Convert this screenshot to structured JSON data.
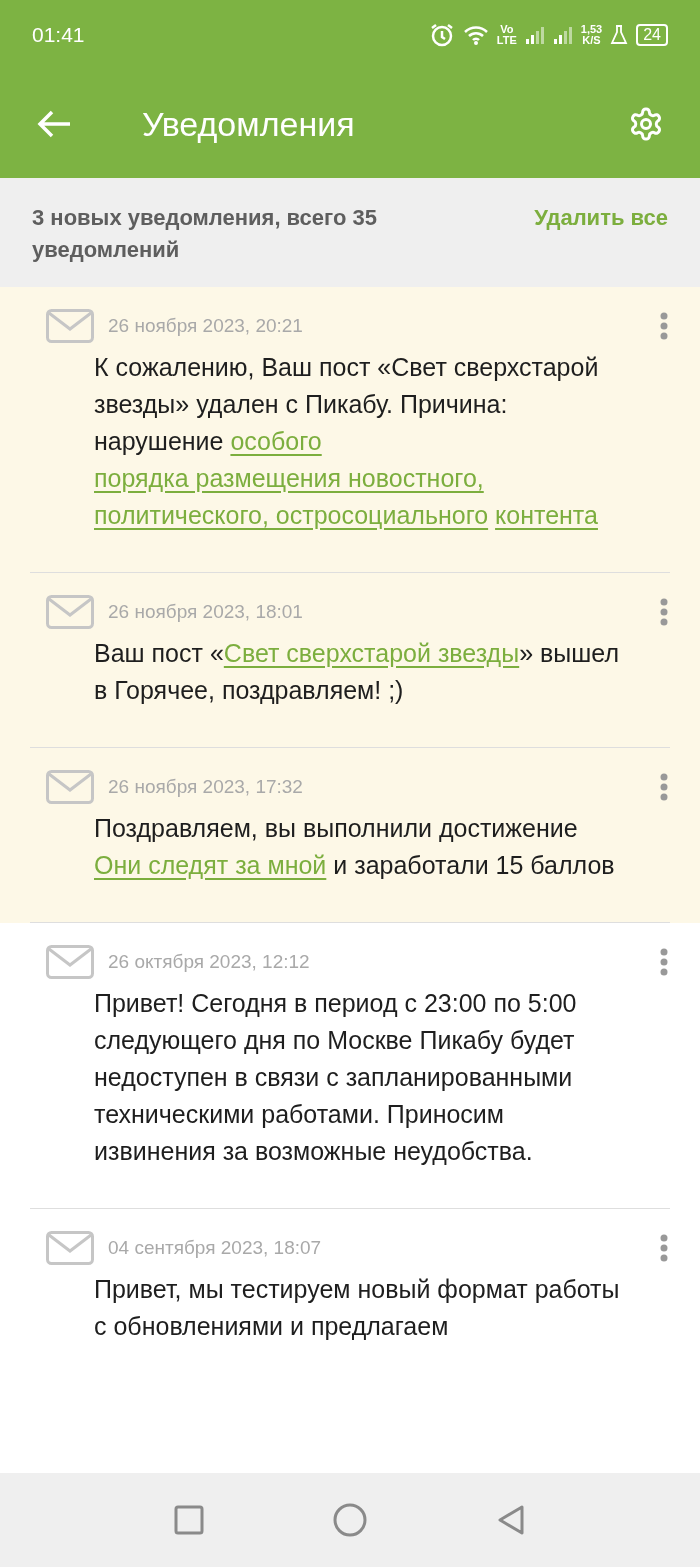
{
  "status_bar": {
    "time": "01:41",
    "network_type_top": "Vo",
    "network_type_bottom": "LTE",
    "speed_value": "1,53",
    "speed_unit": "K/S",
    "battery": "24"
  },
  "app_bar": {
    "title": "Уведомления"
  },
  "summary": {
    "text": "3 новых уведомления, всего 35 уведомлений",
    "action": "Удалить все"
  },
  "notifications": [
    {
      "unread": true,
      "date": "26 ноября 2023, 20:21",
      "body": [
        {
          "kind": "text",
          "text": "К сожалению, Ваш пост «Свет сверхстарой звезды» удален с Пикабу. Причина: нарушение "
        },
        {
          "kind": "link",
          "text": "особого"
        },
        {
          "kind": "link",
          "text": "порядка размещения новостного,"
        },
        {
          "kind": "link",
          "text": "политического, остросоциального"
        },
        {
          "kind": "link",
          "text": "контента"
        }
      ]
    },
    {
      "unread": true,
      "date": "26 ноября 2023, 18:01",
      "body": [
        {
          "kind": "text",
          "text": "Ваш пост «"
        },
        {
          "kind": "link",
          "text": "Свет сверхстарой звезды"
        },
        {
          "kind": "text",
          "text": "» вышел в Горячее, поздравляем! ;)"
        }
      ]
    },
    {
      "unread": true,
      "date": "26 ноября 2023, 17:32",
      "body": [
        {
          "kind": "text",
          "text": "Поздравляем, вы выполнили достижение "
        },
        {
          "kind": "link",
          "text": "Они следят за мной"
        },
        {
          "kind": "text",
          "text": " и заработали 15 баллов"
        }
      ]
    },
    {
      "unread": false,
      "date": "26 октября 2023, 12:12",
      "body": [
        {
          "kind": "text",
          "text": "Привет! Сегодня в период с 23:00 по 5:00 следующего дня по Москве Пикабу будет недоступен в связи с запланированными техническими работами. Приносим извинения за возможные неудобства."
        }
      ]
    },
    {
      "unread": false,
      "date": "04 сентября 2023, 18:07",
      "body": [
        {
          "kind": "text",
          "text": "Привет, мы тестируем новый формат работы с обновлениями и предлагаем"
        }
      ]
    }
  ]
}
